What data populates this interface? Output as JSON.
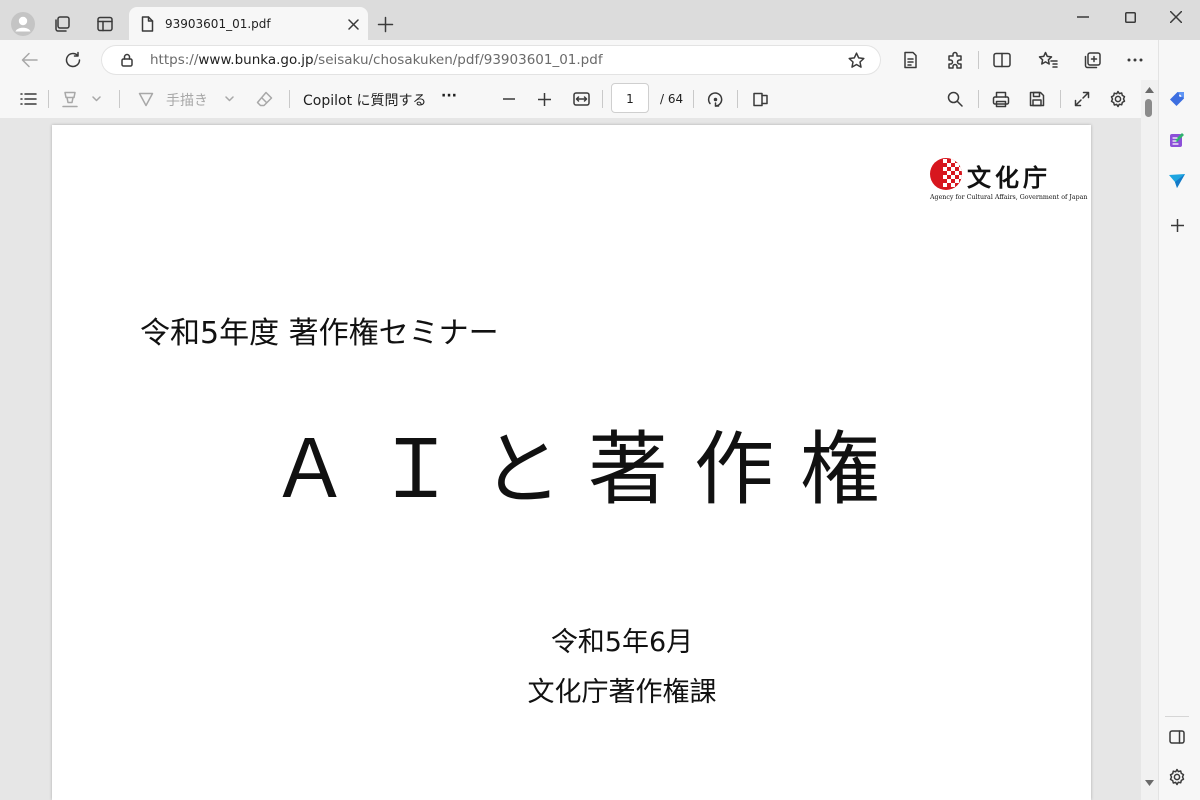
{
  "browser": {
    "tab_title": "93903601_01.pdf",
    "url_scheme": "https://",
    "url_host": "www.bunka.go.jp",
    "url_path": "/seisaku/chosakuken/pdf/93903601_01.pdf"
  },
  "pdf_toolbar": {
    "draw_label": "手描き",
    "copilot_label": "Copilot に質問する",
    "more_label": "···",
    "page_current": "1",
    "page_total": "/ 64"
  },
  "document": {
    "logo_name": "文化庁",
    "logo_english": "Agency for Cultural Affairs, Government of Japan",
    "seminar": "令和5年度 著作権セミナー",
    "title": "ＡＩと著作権",
    "date": "令和5年6月",
    "division": "文化庁著作権課"
  },
  "colors": {
    "accent": "#0f6cbd",
    "logo_red": "#d7161e"
  },
  "icons": {
    "profile": "profile-icon",
    "workspaces": "workspaces-icon",
    "vertical_tabs": "vertical-tabs-icon",
    "new_tab": "plus-icon",
    "back": "back-arrow-icon",
    "refresh": "refresh-icon",
    "site_info": "lock-icon",
    "favorite": "star-icon",
    "copilot": "copilot-icon"
  }
}
